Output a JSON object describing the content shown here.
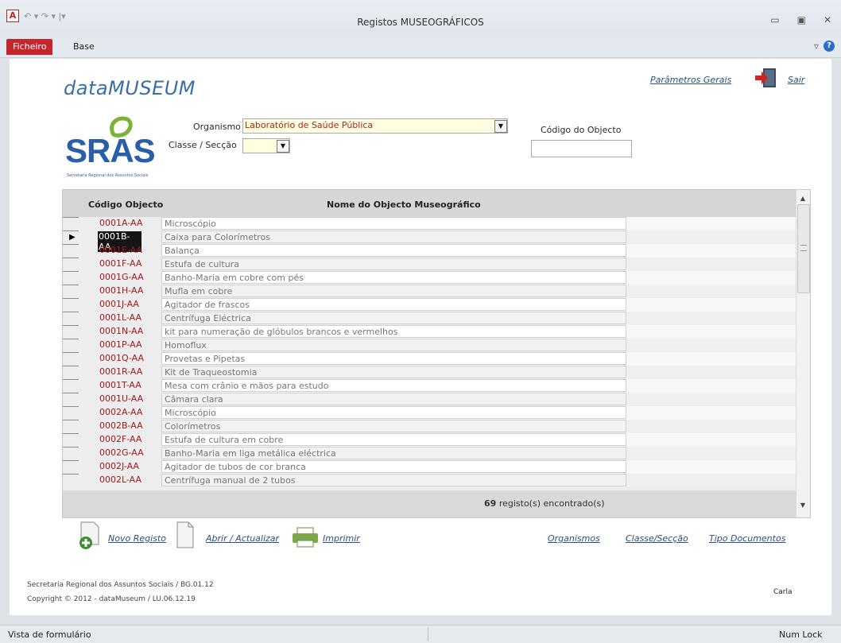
{
  "window": {
    "title": "Registos MUSEOGRÁFICOS",
    "app_icon_letter": "A",
    "quick_access": "↶ ▾ ↷ ▾ |▾",
    "controls": [
      "▭",
      "▣",
      "✕"
    ]
  },
  "ribbon": {
    "file_tab": "Ficheiro",
    "base_tab": "Base",
    "collapse_icon": "▿",
    "help_icon": "?"
  },
  "header": {
    "app_title": "dataMUSEUM",
    "general_params_link": "Parâmetros Gerais",
    "exit_link": "Sair"
  },
  "logo": {
    "text": "SRAS",
    "subtitle": "Secretaria Regional dos Assuntos Sociais"
  },
  "filters": {
    "organism_label": "Organismo",
    "organism_value": "Laboratório de Saúde Pública",
    "class_label": "Classe / Secção",
    "class_value": "",
    "code_label": "Código do Objecto",
    "code_value": ""
  },
  "grid": {
    "col_code": "Código Objecto",
    "col_name": "Nome do Objecto Museográfico",
    "selected_index": 1,
    "rows": [
      {
        "code": "0001A-AA",
        "name": "Microscópio"
      },
      {
        "code": "0001B-AA",
        "name": "Caixa para Colorímetros"
      },
      {
        "code": "0001E-AA",
        "name": "Balança"
      },
      {
        "code": "0001F-AA",
        "name": "Estufa de cultura"
      },
      {
        "code": "0001G-AA",
        "name": "Banho-Maria em cobre com pés"
      },
      {
        "code": "0001H-AA",
        "name": "Mufla em cobre"
      },
      {
        "code": "0001J-AA",
        "name": "Agitador de frascos"
      },
      {
        "code": "0001L-AA",
        "name": "Centrífuga Eléctrica"
      },
      {
        "code": "0001N-AA",
        "name": "kit para numeração de glóbulos brancos e vermelhos"
      },
      {
        "code": "0001P-AA",
        "name": "Homoflux"
      },
      {
        "code": "0001Q-AA",
        "name": "Provetas e Pipetas"
      },
      {
        "code": "0001R-AA",
        "name": "Kit de Traqueostomia"
      },
      {
        "code": "0001T-AA",
        "name": "Mesa com crânio e mãos para estudo"
      },
      {
        "code": "0001U-AA",
        "name": "Câmara clara"
      },
      {
        "code": "0002A-AA",
        "name": "Microscópio"
      },
      {
        "code": "0002B-AA",
        "name": "Colorímetros"
      },
      {
        "code": "0002F-AA",
        "name": "Estufa de cultura em cobre"
      },
      {
        "code": "0002G-AA",
        "name": "Banho-Maria em liga metálica eléctrica"
      },
      {
        "code": "0002J-AA",
        "name": "Agitador de tubos de cor branca"
      },
      {
        "code": "0002L-AA",
        "name": "Centrífuga manual de 2 tubos"
      }
    ],
    "count_number": "69",
    "count_label": "registo(s) encontrado(s)"
  },
  "actions": {
    "new": "Novo Registo",
    "open": "Abrir / Actualizar",
    "print": "Imprimir",
    "organisms": "Organismos",
    "class_section": "Classe/Secção",
    "doc_types": "Tipo Documentos"
  },
  "footer": {
    "line1": "Secretaria Regional dos Assuntos Sociais / BG.01.12",
    "line2": "Copyright © 2012 - dataMuseum / LU.06.12.19",
    "user": "Carla"
  },
  "statusbar": {
    "left": "Vista de formulário",
    "right": "Num Lock"
  },
  "colors": {
    "accent_red": "#c5262d",
    "code_red": "#a01818",
    "title_blue": "#3b6ea5",
    "highlight_yellow": "#ffffe0"
  }
}
